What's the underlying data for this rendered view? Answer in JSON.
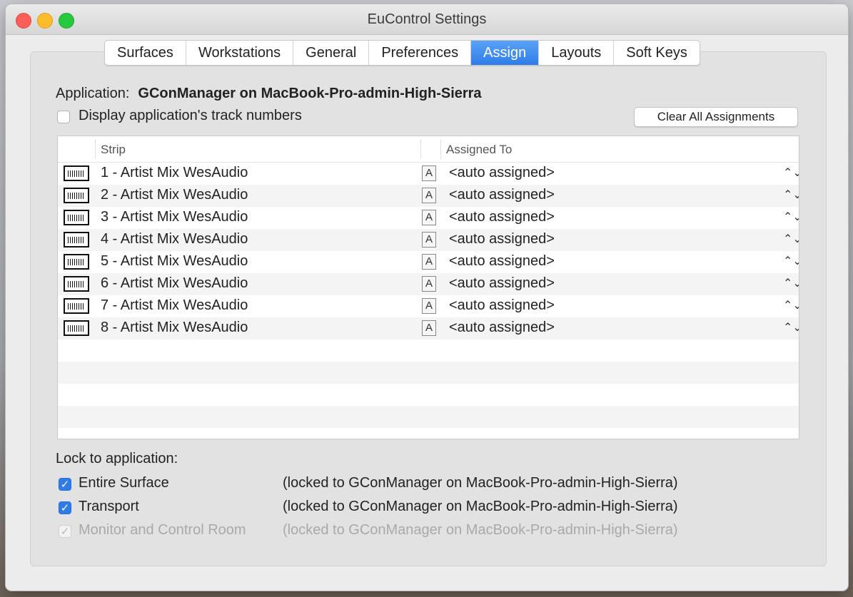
{
  "window": {
    "title": "EuControl Settings"
  },
  "tabs": [
    {
      "label": "Surfaces",
      "active": false
    },
    {
      "label": "Workstations",
      "active": false
    },
    {
      "label": "General",
      "active": false
    },
    {
      "label": "Preferences",
      "active": false
    },
    {
      "label": "Assign",
      "active": true
    },
    {
      "label": "Layouts",
      "active": false
    },
    {
      "label": "Soft Keys",
      "active": false
    }
  ],
  "application": {
    "label": "Application:",
    "name": "GConManager on MacBook-Pro-admin-High-Sierra"
  },
  "display_track_numbers": {
    "label": "Display application's track numbers",
    "checked": false
  },
  "clear_button": "Clear All Assignments",
  "table": {
    "columns": {
      "strip": "Strip",
      "assigned": "Assigned To"
    },
    "rows": [
      {
        "strip": "1 - Artist Mix WesAudio",
        "assigned": "<auto assigned>"
      },
      {
        "strip": "2 - Artist Mix WesAudio",
        "assigned": "<auto assigned>"
      },
      {
        "strip": "3 - Artist Mix WesAudio",
        "assigned": "<auto assigned>"
      },
      {
        "strip": "4 - Artist Mix WesAudio",
        "assigned": "<auto assigned>"
      },
      {
        "strip": "5 - Artist Mix WesAudio",
        "assigned": "<auto assigned>"
      },
      {
        "strip": "6 - Artist Mix WesAudio",
        "assigned": "<auto assigned>"
      },
      {
        "strip": "7 - Artist Mix WesAudio",
        "assigned": "<auto assigned>"
      },
      {
        "strip": "8 - Artist Mix WesAudio",
        "assigned": "<auto assigned>"
      }
    ],
    "icons": {
      "strip": "surface-strip-icon",
      "lock": "A",
      "stepper": "⌃⌄"
    }
  },
  "lock": {
    "title": "Lock to application:",
    "items": [
      {
        "label": "Entire Surface",
        "checked": true,
        "enabled": true,
        "note": "(locked to GConManager on MacBook-Pro-admin-High-Sierra)"
      },
      {
        "label": "Transport",
        "checked": true,
        "enabled": true,
        "note": "(locked to GConManager on MacBook-Pro-admin-High-Sierra)"
      },
      {
        "label": "Monitor and Control Room",
        "checked": true,
        "enabled": false,
        "note": "(locked to GConManager on MacBook-Pro-admin-High-Sierra)"
      }
    ]
  },
  "colors": {
    "accent": "#2f7ce9"
  }
}
